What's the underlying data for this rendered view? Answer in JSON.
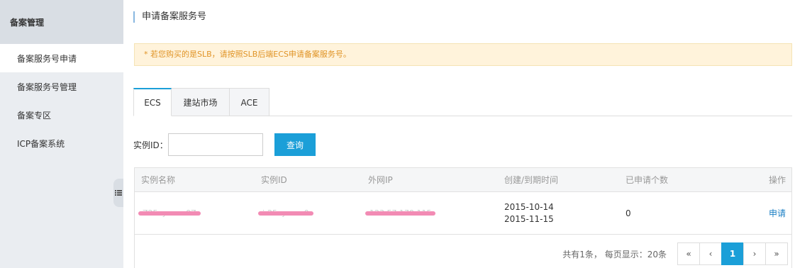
{
  "sidebar": {
    "title": "备案管理",
    "items": [
      {
        "label": "备案服务号申请"
      },
      {
        "label": "备案服务号管理"
      },
      {
        "label": "备案专区"
      },
      {
        "label": "ICP备案系统"
      }
    ],
    "active_index": 0
  },
  "page": {
    "title": "申请备案服务号",
    "notice": "* 若您购买的是SLB，请按照SLB后端ECS申请备案服务号。"
  },
  "tabs": [
    {
      "label": "ECS"
    },
    {
      "label": "建站市场"
    },
    {
      "label": "ACE"
    }
  ],
  "active_tab": 0,
  "search": {
    "label": "实例ID：",
    "value": "",
    "placeholder": "",
    "button_label": "查询"
  },
  "table": {
    "columns": [
      "实例名称",
      "实例ID",
      "外网IP",
      "创建/到期时间",
      "已申请个数",
      "操作"
    ],
    "rows": [
      {
        "name": "Z25cy.vwc.0Z",
        "id": "i-25cyvwc.0",
        "ip": "123.57.179.115",
        "created": "2015-10-14",
        "expires": "2015-11-15",
        "count": "0",
        "action": "申请"
      }
    ]
  },
  "pagination": {
    "info": "共有1条， 每页显示：20条",
    "first": "«",
    "prev": "‹",
    "current": "1",
    "next": "›",
    "last": "»"
  },
  "colors": {
    "accent": "#1b9fd8",
    "notice_bg": "#fff3db",
    "notice_text": "#e09427",
    "sidebar_bg": "#eaedf1"
  }
}
